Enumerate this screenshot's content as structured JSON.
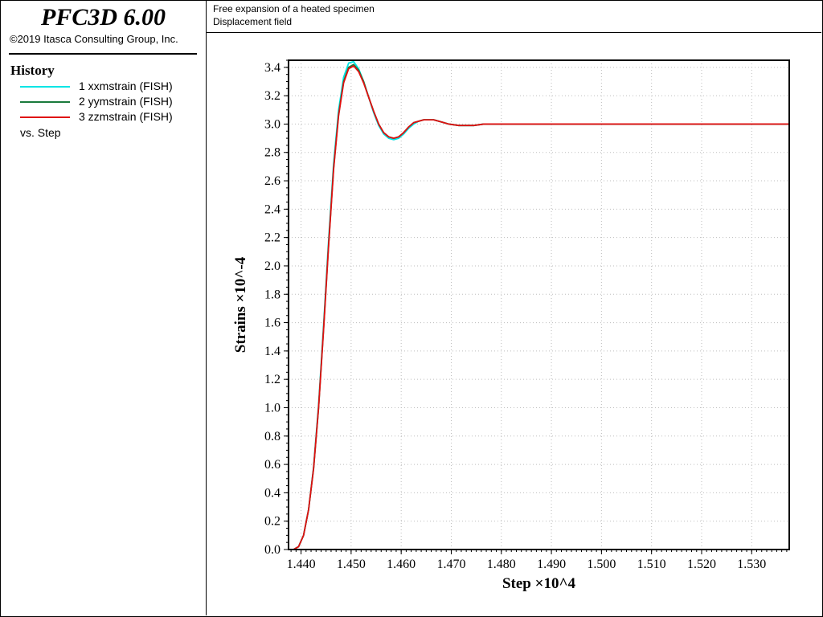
{
  "app": {
    "title": "PFC3D 6.00",
    "copyright": "©2019 Itasca Consulting Group, Inc."
  },
  "plot": {
    "title": "Free expansion of a heated specimen",
    "subtitle": "Displacement field"
  },
  "legend": {
    "heading": "History",
    "items": [
      {
        "label": "1 xxmstrain (FISH)",
        "color": "#00e5e5"
      },
      {
        "label": "2 yymstrain (FISH)",
        "color": "#1a7a3c"
      },
      {
        "label": "3 zzmstrain (FISH)",
        "color": "#e01010"
      }
    ],
    "vs_label": "vs. Step"
  },
  "chart_data": {
    "type": "line",
    "xlabel": "Step ×10^4",
    "ylabel": "Strains ×10^-4",
    "xlim": [
      1.4375,
      1.5375
    ],
    "ylim": [
      0.0,
      3.45
    ],
    "x_ticks": [
      "1.440",
      "1.450",
      "1.460",
      "1.470",
      "1.480",
      "1.490",
      "1.500",
      "1.510",
      "1.520",
      "1.530"
    ],
    "y_ticks": [
      "0.0",
      "0.2",
      "0.4",
      "0.6",
      "0.8",
      "1.0",
      "1.2",
      "1.4",
      "1.6",
      "1.8",
      "2.0",
      "2.2",
      "2.4",
      "2.6",
      "2.8",
      "3.0",
      "3.2",
      "3.4"
    ],
    "grid": true,
    "legend_placement": "left panel",
    "series": [
      {
        "name": "1 xxmstrain (FISH)",
        "color": "#00e5e5",
        "x": [
          1.4385,
          1.4395,
          1.4405,
          1.4415,
          1.4425,
          1.4435,
          1.4445,
          1.4455,
          1.4465,
          1.4475,
          1.4485,
          1.4495,
          1.4505,
          1.4515,
          1.4525,
          1.4535,
          1.4545,
          1.4555,
          1.4565,
          1.4575,
          1.4585,
          1.4595,
          1.4605,
          1.4615,
          1.4625,
          1.4635,
          1.4645,
          1.4655,
          1.4665,
          1.4675,
          1.4685,
          1.4695,
          1.4705,
          1.4715,
          1.4725,
          1.4735,
          1.4745,
          1.4755,
          1.4765,
          1.4775,
          1.4785,
          1.4805,
          1.4825,
          1.4845,
          1.4865,
          1.4885,
          1.4905,
          1.4925,
          1.4945,
          1.4965,
          1.4985,
          1.5005,
          1.5025,
          1.5045,
          1.5065,
          1.5085,
          1.5105,
          1.5125,
          1.5145,
          1.5165,
          1.5185,
          1.5205,
          1.5225,
          1.5245,
          1.5265,
          1.5285,
          1.5305,
          1.5325,
          1.5345,
          1.5375
        ],
        "y": [
          0.0,
          0.02,
          0.1,
          0.28,
          0.58,
          1.02,
          1.58,
          2.18,
          2.72,
          3.1,
          3.33,
          3.43,
          3.44,
          3.39,
          3.3,
          3.19,
          3.08,
          2.99,
          2.93,
          2.9,
          2.89,
          2.9,
          2.93,
          2.97,
          3.0,
          3.02,
          3.03,
          3.03,
          3.03,
          3.02,
          3.01,
          3.0,
          2.995,
          2.99,
          2.99,
          2.99,
          2.99,
          2.995,
          3.0,
          3.0,
          3.0,
          3.0,
          3.0,
          3.0,
          3.0,
          3.0,
          3.0,
          3.0,
          3.0,
          3.0,
          3.0,
          3.0,
          3.0,
          3.0,
          3.0,
          3.0,
          3.0,
          3.0,
          3.0,
          3.0,
          3.0,
          3.0,
          3.0,
          3.0,
          3.0,
          3.0,
          3.0,
          3.0,
          3.0,
          3.0
        ]
      },
      {
        "name": "2 yymstrain (FISH)",
        "color": "#1a7a3c",
        "x": [
          1.4385,
          1.4395,
          1.4405,
          1.4415,
          1.4425,
          1.4435,
          1.4445,
          1.4455,
          1.4465,
          1.4475,
          1.4485,
          1.4495,
          1.4505,
          1.4515,
          1.4525,
          1.4535,
          1.4545,
          1.4555,
          1.4565,
          1.4575,
          1.4585,
          1.4595,
          1.4605,
          1.4615,
          1.4625,
          1.4635,
          1.4645,
          1.4655,
          1.4665,
          1.4675,
          1.4685,
          1.4695,
          1.4705,
          1.4715,
          1.4725,
          1.4735,
          1.4745,
          1.4755,
          1.4765,
          1.4775,
          1.4785,
          1.4805,
          1.4825,
          1.4845,
          1.4865,
          1.4885,
          1.4905,
          1.4925,
          1.4945,
          1.4965,
          1.4985,
          1.5005,
          1.5025,
          1.5045,
          1.5065,
          1.5085,
          1.5105,
          1.5125,
          1.5145,
          1.5165,
          1.5185,
          1.5205,
          1.5225,
          1.5245,
          1.5265,
          1.5285,
          1.5305,
          1.5325,
          1.5345,
          1.5375
        ],
        "y": [
          0.0,
          0.02,
          0.1,
          0.28,
          0.57,
          1.0,
          1.56,
          2.15,
          2.69,
          3.07,
          3.3,
          3.4,
          3.42,
          3.38,
          3.3,
          3.19,
          3.09,
          3.0,
          2.94,
          2.91,
          2.9,
          2.91,
          2.94,
          2.98,
          3.01,
          3.02,
          3.03,
          3.03,
          3.03,
          3.02,
          3.01,
          3.0,
          2.995,
          2.99,
          2.99,
          2.99,
          2.99,
          2.995,
          3.0,
          3.0,
          3.0,
          3.0,
          3.0,
          3.0,
          3.0,
          3.0,
          3.0,
          3.0,
          3.0,
          3.0,
          3.0,
          3.0,
          3.0,
          3.0,
          3.0,
          3.0,
          3.0,
          3.0,
          3.0,
          3.0,
          3.0,
          3.0,
          3.0,
          3.0,
          3.0,
          3.0,
          3.0,
          3.0,
          3.0,
          3.0
        ]
      },
      {
        "name": "3 zzmstrain (FISH)",
        "color": "#e01010",
        "x": [
          1.4385,
          1.4395,
          1.4405,
          1.4415,
          1.4425,
          1.4435,
          1.4445,
          1.4455,
          1.4465,
          1.4475,
          1.4485,
          1.4495,
          1.4505,
          1.4515,
          1.4525,
          1.4535,
          1.4545,
          1.4555,
          1.4565,
          1.4575,
          1.4585,
          1.4595,
          1.4605,
          1.4615,
          1.4625,
          1.4635,
          1.4645,
          1.4655,
          1.4665,
          1.4675,
          1.4685,
          1.4695,
          1.4705,
          1.4715,
          1.4725,
          1.4735,
          1.4745,
          1.4755,
          1.4765,
          1.4775,
          1.4785,
          1.4805,
          1.4825,
          1.4845,
          1.4865,
          1.4885,
          1.4905,
          1.4925,
          1.4945,
          1.4965,
          1.4985,
          1.5005,
          1.5025,
          1.5045,
          1.5065,
          1.5085,
          1.5105,
          1.5125,
          1.5145,
          1.5165,
          1.5185,
          1.5205,
          1.5225,
          1.5245,
          1.5265,
          1.5285,
          1.5305,
          1.5325,
          1.5345,
          1.5375
        ],
        "y": [
          0.0,
          0.02,
          0.1,
          0.28,
          0.57,
          1.0,
          1.55,
          2.14,
          2.68,
          3.06,
          3.29,
          3.39,
          3.41,
          3.37,
          3.29,
          3.19,
          3.09,
          3.0,
          2.94,
          2.91,
          2.9,
          2.91,
          2.94,
          2.98,
          3.01,
          3.02,
          3.03,
          3.03,
          3.03,
          3.02,
          3.01,
          3.0,
          2.995,
          2.99,
          2.99,
          2.99,
          2.99,
          2.995,
          3.0,
          3.0,
          3.0,
          3.0,
          3.0,
          3.0,
          3.0,
          3.0,
          3.0,
          3.0,
          3.0,
          3.0,
          3.0,
          3.0,
          3.0,
          3.0,
          3.0,
          3.0,
          3.0,
          3.0,
          3.0,
          3.0,
          3.0,
          3.0,
          3.0,
          3.0,
          3.0,
          3.0,
          3.0,
          3.0,
          3.0,
          3.0
        ]
      }
    ]
  }
}
